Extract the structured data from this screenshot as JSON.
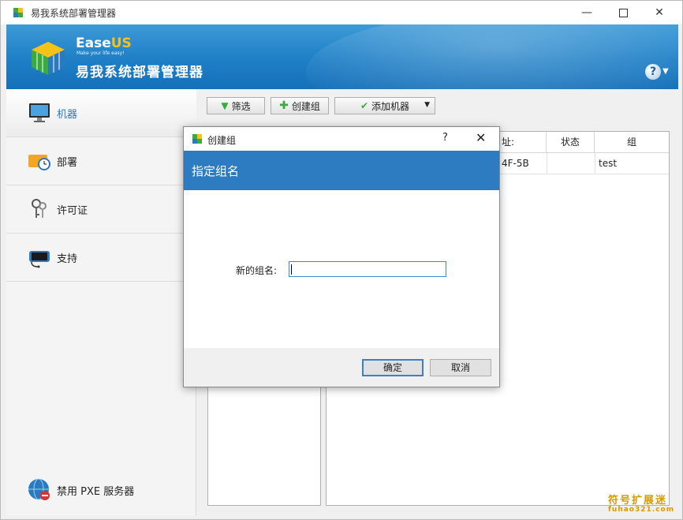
{
  "window": {
    "title": "易我系统部署管理器",
    "icon": "easeus-cube-icon"
  },
  "banner": {
    "brand_ease": "Ease",
    "brand_us": "US",
    "tagline": "Make your life easy!",
    "product": "易我系统部署管理器",
    "help_label": "?"
  },
  "sidebar": {
    "items": [
      {
        "label": "机器",
        "icon": "monitor-icon"
      },
      {
        "label": "部署",
        "icon": "deploy-clock-icon"
      },
      {
        "label": "许可证",
        "icon": "keys-icon"
      },
      {
        "label": "支持",
        "icon": "headset-icon"
      }
    ],
    "pxe_label": "禁用 PXE 服务器"
  },
  "toolbar": {
    "filter": "筛选",
    "create_group": "创建组",
    "add_machine": "添加机器"
  },
  "grid": {
    "columns": {
      "address": "址:",
      "status": "状态",
      "group": "组"
    },
    "rows": [
      {
        "address": "4F-5B",
        "status": "",
        "group": "test"
      }
    ]
  },
  "dialog": {
    "title": "创建组",
    "help": "?",
    "close": "✕",
    "header": "指定组名",
    "field_label": "新的组名:",
    "field_value": "",
    "ok": "确定",
    "cancel": "取消"
  },
  "watermark": {
    "text": "符号扩展迷",
    "url": "fuhao321.com"
  },
  "colors": {
    "banner_blue": "#1e7fc6",
    "dialog_header": "#2d7cc1",
    "accent_gold": "#f5c318"
  }
}
